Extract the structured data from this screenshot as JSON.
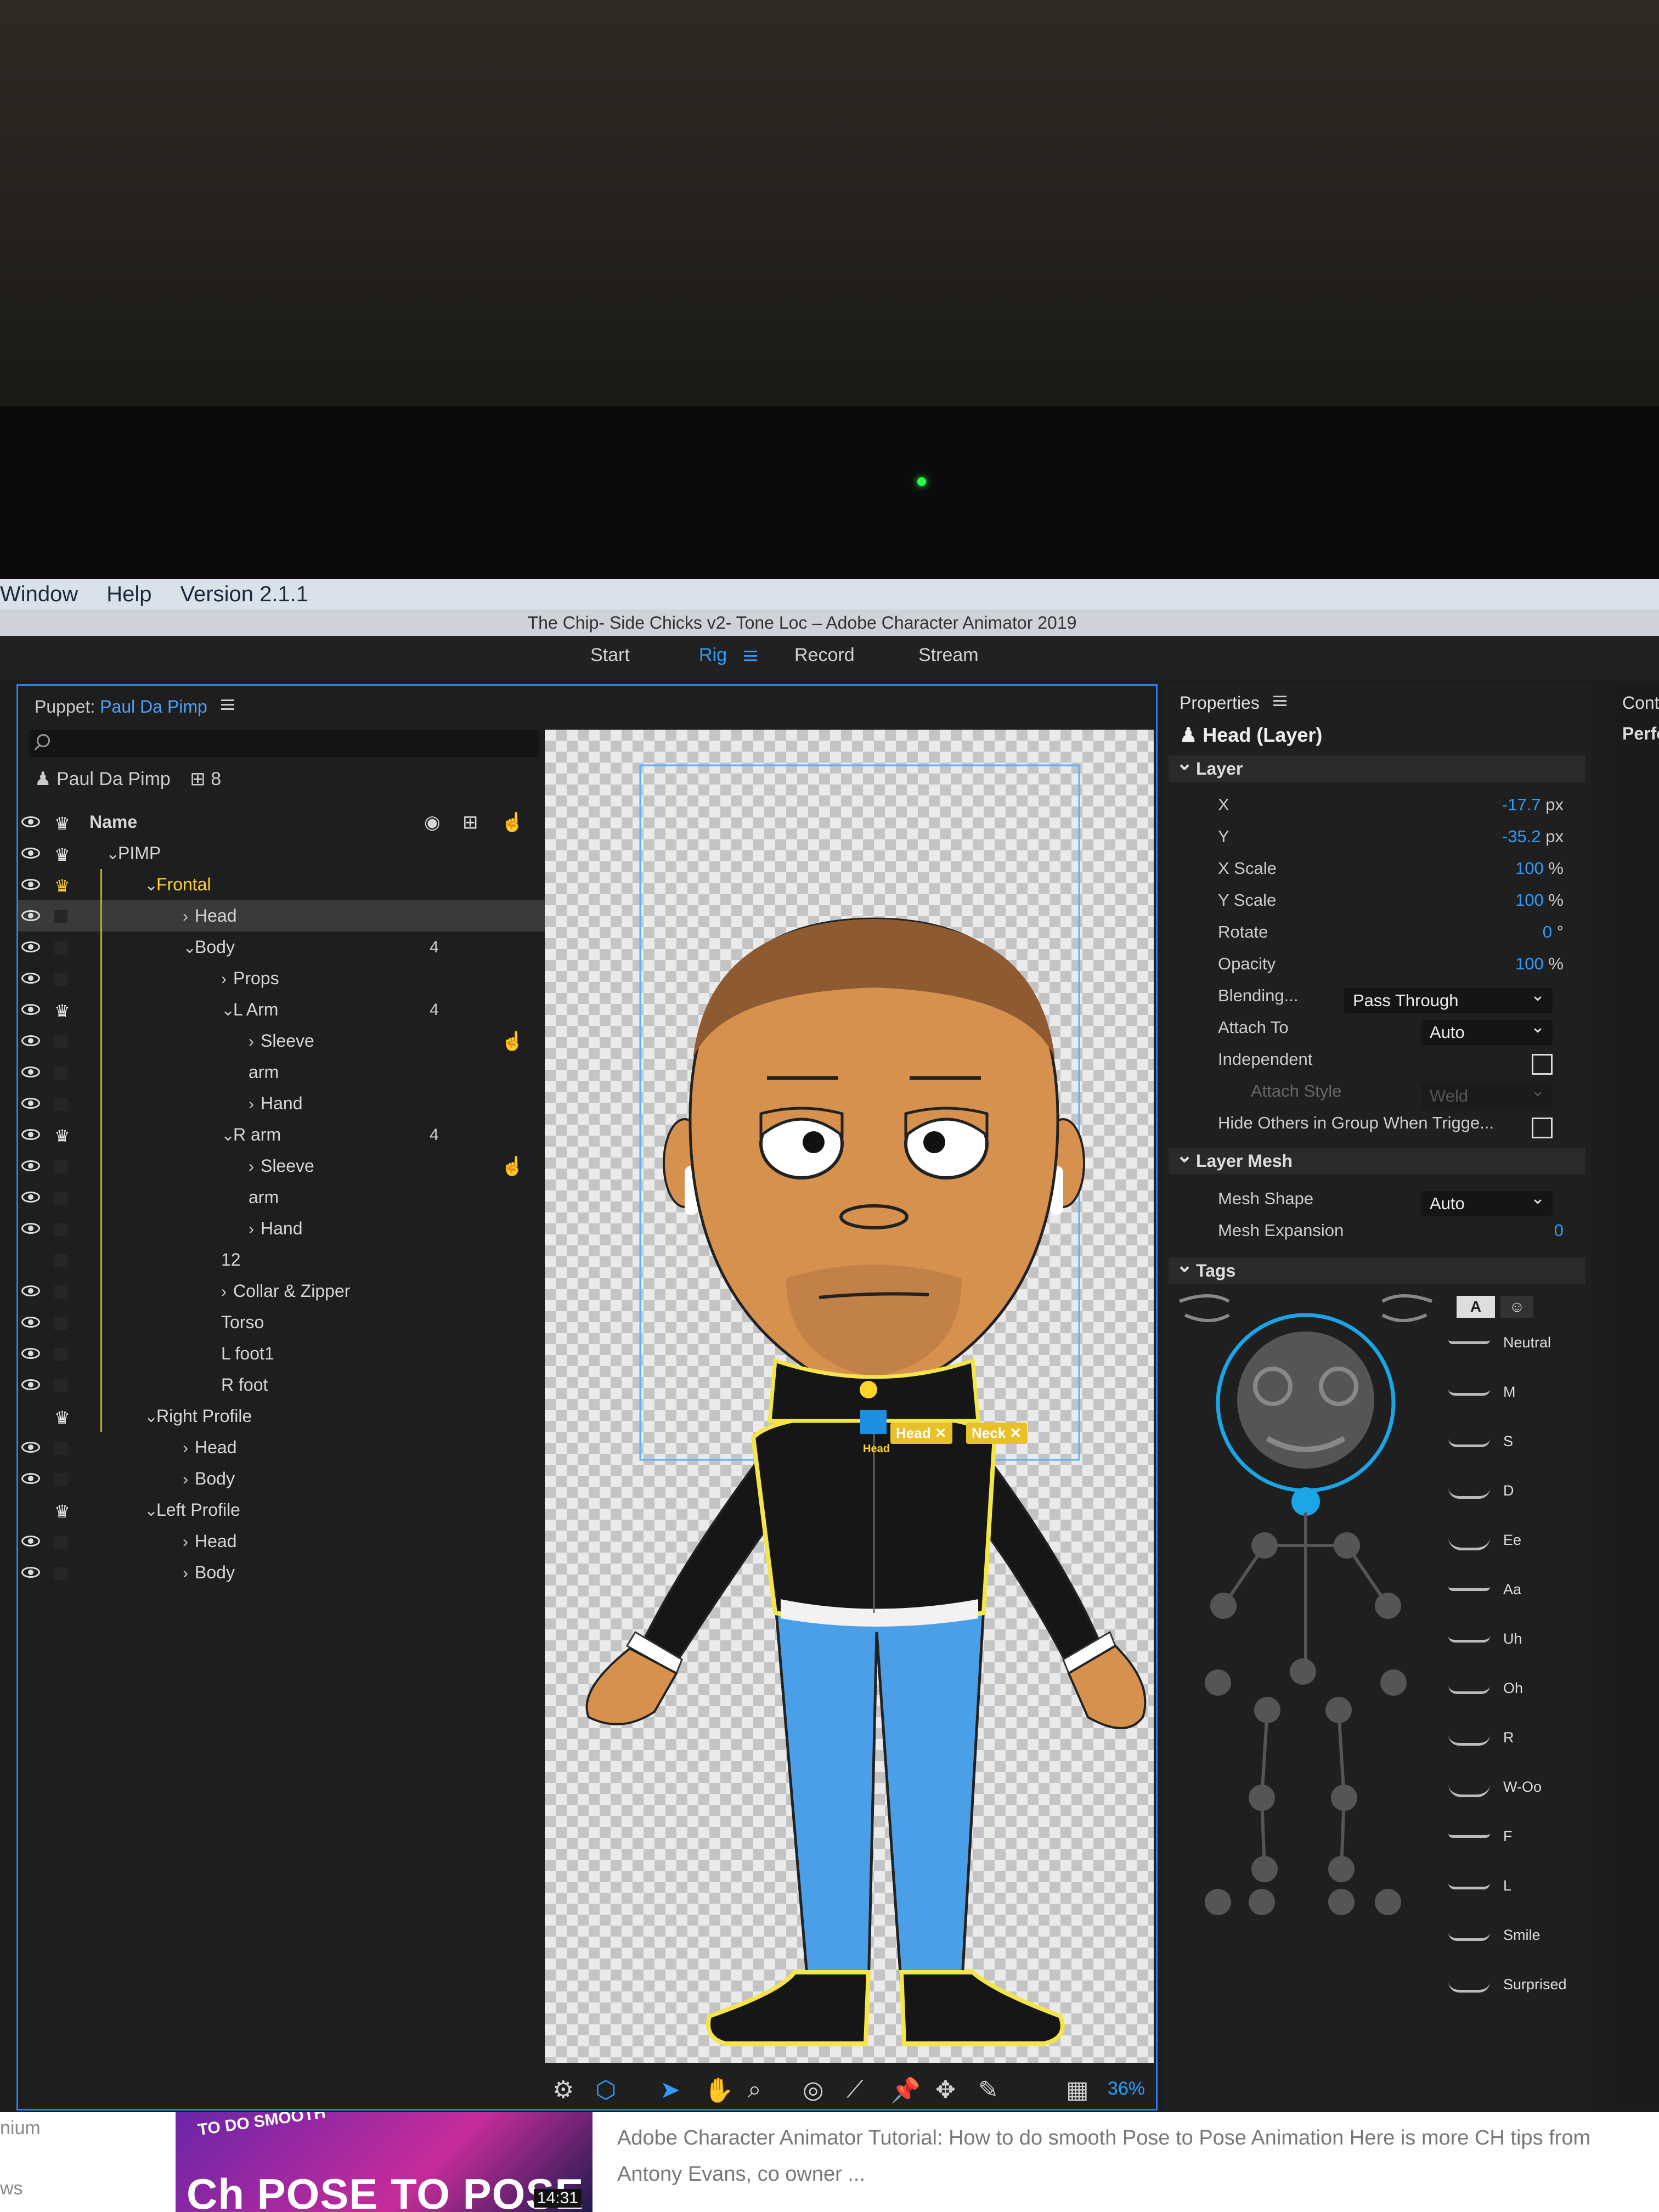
{
  "menubar": {
    "items": [
      "Window",
      "Help",
      "Version 2.1.1"
    ]
  },
  "window_title": "The Chip- Side Chicks v2- Tone Loc – Adobe Character Animator 2019",
  "workspace_tabs": [
    {
      "label": "Start",
      "active": false
    },
    {
      "label": "Rig",
      "active": true
    },
    {
      "label": "Record",
      "active": false
    },
    {
      "label": "Stream",
      "active": false
    }
  ],
  "puppet_panel": {
    "label": "Puppet:",
    "puppet_name": "Paul Da Pimp",
    "root_name": "Paul Da Pimp",
    "root_count": "8",
    "column_name": "Name",
    "layers": [
      {
        "name": "PIMP",
        "indent": 1,
        "expand": "⌄",
        "crown": "white",
        "count": ""
      },
      {
        "name": "Frontal",
        "indent": 2,
        "expand": "⌄",
        "crown": "yellow",
        "count": "",
        "highlight": true
      },
      {
        "name": "Head",
        "indent": 3,
        "expand": "›",
        "crown": "",
        "count": "",
        "selected": true
      },
      {
        "name": "Body",
        "indent": 3,
        "expand": "⌄",
        "crown": "",
        "count": "4"
      },
      {
        "name": "Props",
        "indent": 4,
        "expand": "›",
        "crown": "",
        "count": ""
      },
      {
        "name": "L Arm",
        "indent": 4,
        "expand": "⌄",
        "crown": "white",
        "count": "4"
      },
      {
        "name": "Sleeve",
        "indent": 5,
        "expand": "›",
        "crown": "",
        "count": "",
        "hand": true
      },
      {
        "name": "arm",
        "indent": 5,
        "expand": "",
        "crown": "",
        "count": ""
      },
      {
        "name": "Hand",
        "indent": 5,
        "expand": "›",
        "crown": "",
        "count": ""
      },
      {
        "name": "R arm",
        "indent": 4,
        "expand": "⌄",
        "crown": "white",
        "count": "4"
      },
      {
        "name": "Sleeve",
        "indent": 5,
        "expand": "›",
        "crown": "",
        "count": "",
        "hand": true
      },
      {
        "name": "arm",
        "indent": 5,
        "expand": "",
        "crown": "",
        "count": ""
      },
      {
        "name": "Hand",
        "indent": 5,
        "expand": "›",
        "crown": "",
        "count": ""
      },
      {
        "name": "12",
        "indent": 4,
        "expand": "",
        "crown": "",
        "count": "",
        "noeye": true
      },
      {
        "name": "Collar & Zipper",
        "indent": 4,
        "expand": "›",
        "crown": "",
        "count": ""
      },
      {
        "name": "Torso",
        "indent": 4,
        "expand": "",
        "crown": "",
        "count": ""
      },
      {
        "name": "L foot1",
        "indent": 4,
        "expand": "",
        "crown": "",
        "count": ""
      },
      {
        "name": "R foot",
        "indent": 4,
        "expand": "",
        "crown": "",
        "count": ""
      },
      {
        "name": "Right Profile",
        "indent": 2,
        "expand": "⌄",
        "crown": "white",
        "count": "",
        "noeye": true
      },
      {
        "name": "Head",
        "indent": 3,
        "expand": "›",
        "crown": "",
        "count": ""
      },
      {
        "name": "Body",
        "indent": 3,
        "expand": "›",
        "crown": "",
        "count": ""
      },
      {
        "name": "Left Profile",
        "indent": 2,
        "expand": "⌄",
        "crown": "white",
        "count": "",
        "noeye": true
      },
      {
        "name": "Head",
        "indent": 3,
        "expand": "›",
        "crown": "",
        "count": ""
      },
      {
        "name": "Body",
        "indent": 3,
        "expand": "›",
        "crown": "",
        "count": ""
      }
    ]
  },
  "canvas": {
    "tags": [
      "Head",
      "Neck"
    ],
    "handle_label": "Head",
    "zoom": "36%"
  },
  "properties": {
    "title": "Properties",
    "layer_title": "Head (Layer)",
    "sections": {
      "layer": "Layer",
      "mesh": "Layer Mesh",
      "tags": "Tags"
    },
    "x": {
      "label": "X",
      "value": "-17.7",
      "unit": "px"
    },
    "y": {
      "label": "Y",
      "value": "-35.2",
      "unit": "px"
    },
    "xscale": {
      "label": "X Scale",
      "value": "100",
      "unit": "%"
    },
    "yscale": {
      "label": "Y Scale",
      "value": "100",
      "unit": "%"
    },
    "rotate": {
      "label": "Rotate",
      "value": "0",
      "unit": "°"
    },
    "opacity": {
      "label": "Opacity",
      "value": "100",
      "unit": "%"
    },
    "blending": {
      "label": "Blending...",
      "value": "Pass Through"
    },
    "attach_to": {
      "label": "Attach To",
      "value": "Auto"
    },
    "independent": {
      "label": "Independent"
    },
    "attach_style": {
      "label": "Attach Style",
      "value": "Weld"
    },
    "hide_others": {
      "label": "Hide Others in Group When Trigge..."
    },
    "mesh_shape": {
      "label": "Mesh Shape",
      "value": "Auto"
    },
    "mesh_expansion": {
      "label": "Mesh Expansion",
      "value": "0"
    },
    "tag_filters": [
      "A",
      "☺"
    ],
    "visemes": [
      "Neutral",
      "M",
      "S",
      "D",
      "Ee",
      "Aa",
      "Uh",
      "Oh",
      "R",
      "W-Oo",
      "F",
      "L",
      "Smile",
      "Surprised"
    ]
  },
  "side_panel": {
    "labels": [
      "Cont",
      "Perfo"
    ]
  },
  "bottom_strip": {
    "left_text_1": "nium",
    "left_text_2": "ws",
    "thumb_top": "TO DO SMOOTH",
    "thumb_title": "Ch POSE TO POSE",
    "thumb_time": "14:31",
    "description": "Adobe Character Animator Tutorial: How to do smooth Pose to Pose Animation Here is more CH tips from Antony Evans, co owner ..."
  },
  "colors": {
    "accent": "#2d9dff",
    "tag": "#e8c12a",
    "outline": "#f4e64a",
    "skin": "#d6914e",
    "jeans": "#4a9fe6"
  }
}
